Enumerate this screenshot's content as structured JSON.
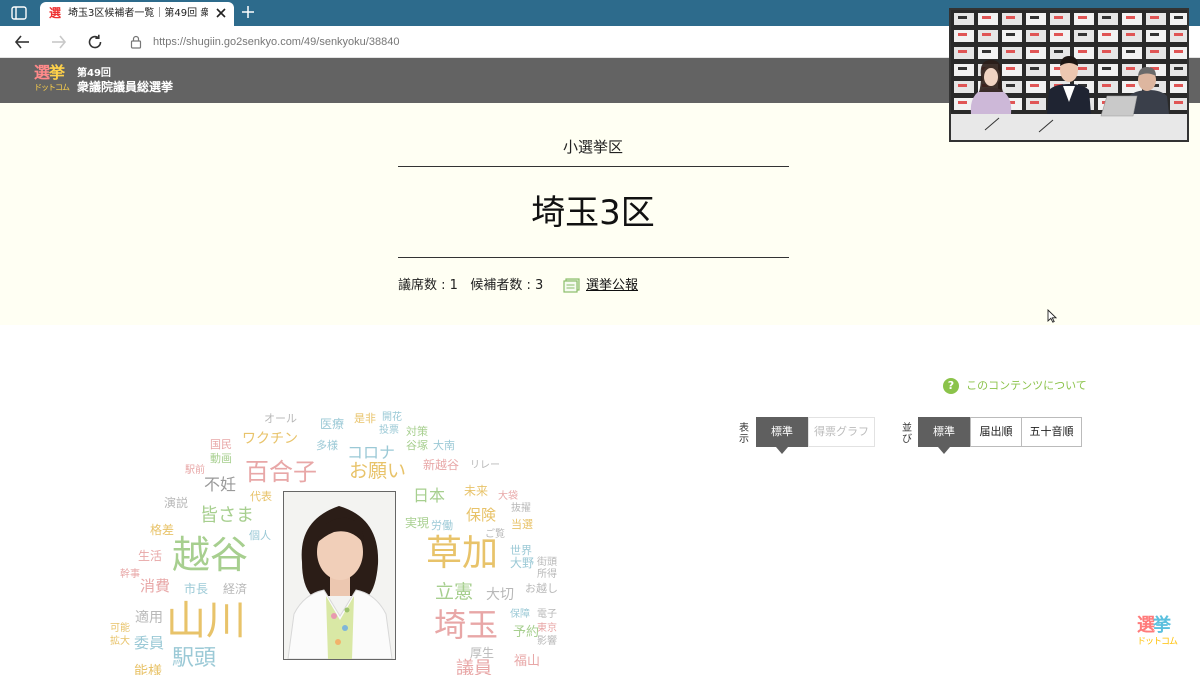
{
  "browser": {
    "tab_title": "埼玉3区候補者一覧｜第49回 衆議院議員総選挙",
    "tab_favicon": "選",
    "url": "https://shugiin.go2senkyo.com/49/senkyoku/38840"
  },
  "header": {
    "logo_kanji_1": "選",
    "logo_kanji_2": "挙",
    "logo_sub": "ドットコム",
    "election_number": "第49回",
    "election_name": "衆議院議員総選挙"
  },
  "district": {
    "type": "小選挙区",
    "name": "埼玉3区",
    "seats": "議席数 : 1",
    "candidates": "候補者数 : 3",
    "bulletin_link": "選挙公報"
  },
  "content": {
    "about_icon": "?",
    "about_link": "このコンテンツについて",
    "display_label": "表示",
    "display_standard": "標準",
    "display_graph": "得票グラフ",
    "sort_label": "並び",
    "sort_standard": "標準",
    "sort_filing": "届出順",
    "sort_gojuon": "五十音順"
  },
  "wordcloud": [
    {
      "text": "オール",
      "color": "#b8b8b8",
      "size": 11
    },
    {
      "text": "医療",
      "color": "#9bc9d6",
      "size": 12
    },
    {
      "text": "是非",
      "color": "#e8c36a",
      "size": 11
    },
    {
      "text": "開花",
      "color": "#9bc9d6",
      "size": 10
    },
    {
      "text": "国民",
      "color": "#e8a7a7",
      "size": 11
    },
    {
      "text": "ワクチン",
      "color": "#e8c36a",
      "size": 14
    },
    {
      "text": "多様",
      "color": "#9bc9d6",
      "size": 11
    },
    {
      "text": "投票",
      "color": "#9bc9d6",
      "size": 10
    },
    {
      "text": "対策",
      "color": "#a7cf8f",
      "size": 11
    },
    {
      "text": "動画",
      "color": "#a7cf8f",
      "size": 11
    },
    {
      "text": "谷塚",
      "color": "#a7cf8f",
      "size": 11
    },
    {
      "text": "大南",
      "color": "#9bc9d6",
      "size": 11
    },
    {
      "text": "コロナ",
      "color": "#9bc9d6",
      "size": 16
    },
    {
      "text": "百合子",
      "color": "#e8a7a7",
      "size": 24
    },
    {
      "text": "駅前",
      "color": "#e8a7a7",
      "size": 10
    },
    {
      "text": "お願い",
      "color": "#e8c36a",
      "size": 19
    },
    {
      "text": "新越谷",
      "color": "#e8a7a7",
      "size": 12
    },
    {
      "text": "リレー",
      "color": "#b8b8b8",
      "size": 10
    },
    {
      "text": "不妊",
      "color": "#9a9a9a",
      "size": 16
    },
    {
      "text": "演説",
      "color": "#b8b8b8",
      "size": 12
    },
    {
      "text": "代表",
      "color": "#e8c36a",
      "size": 11
    },
    {
      "text": "日本",
      "color": "#a7cf8f",
      "size": 16
    },
    {
      "text": "未来",
      "color": "#e8c36a",
      "size": 12
    },
    {
      "text": "大袋",
      "color": "#e8a7a7",
      "size": 10
    },
    {
      "text": "皆さま",
      "color": "#a7cf8f",
      "size": 18
    },
    {
      "text": "保険",
      "color": "#e8c36a",
      "size": 15
    },
    {
      "text": "抜擢",
      "color": "#b8b8b8",
      "size": 10
    },
    {
      "text": "格差",
      "color": "#e8c36a",
      "size": 12
    },
    {
      "text": "個人",
      "color": "#9bc9d6",
      "size": 11
    },
    {
      "text": "実現",
      "color": "#a7cf8f",
      "size": 12
    },
    {
      "text": "労働",
      "color": "#9bc9d6",
      "size": 11
    },
    {
      "text": "当選",
      "color": "#e8c36a",
      "size": 11
    },
    {
      "text": "ご覧",
      "color": "#b8b8b8",
      "size": 10
    },
    {
      "text": "越谷",
      "color": "#a7cf8f",
      "size": 38
    },
    {
      "text": "草加",
      "color": "#e8c36a",
      "size": 36
    },
    {
      "text": "生活",
      "color": "#e8a7a7",
      "size": 12
    },
    {
      "text": "世界",
      "color": "#9bc9d6",
      "size": 11
    },
    {
      "text": "大野",
      "color": "#9bc9d6",
      "size": 12
    },
    {
      "text": "街頭",
      "color": "#b8b8b8",
      "size": 10
    },
    {
      "text": "幹事",
      "color": "#e8a7a7",
      "size": 10
    },
    {
      "text": "所得",
      "color": "#b8b8b8",
      "size": 10
    },
    {
      "text": "消費",
      "color": "#e8a7a7",
      "size": 15
    },
    {
      "text": "市長",
      "color": "#9bc9d6",
      "size": 12
    },
    {
      "text": "経済",
      "color": "#b8b8b8",
      "size": 12
    },
    {
      "text": "立憲",
      "color": "#a7cf8f",
      "size": 19
    },
    {
      "text": "大切",
      "color": "#b8b8b8",
      "size": 14
    },
    {
      "text": "お越し",
      "color": "#b8b8b8",
      "size": 11
    },
    {
      "text": "山川",
      "color": "#e8c36a",
      "size": 40
    },
    {
      "text": "保障",
      "color": "#9bc9d6",
      "size": 10
    },
    {
      "text": "電子",
      "color": "#b8b8b8",
      "size": 10
    },
    {
      "text": "適用",
      "color": "#b8b8b8",
      "size": 14
    },
    {
      "text": "可能",
      "color": "#e8c36a",
      "size": 10
    },
    {
      "text": "埼玉",
      "color": "#e8a7a7",
      "size": 32
    },
    {
      "text": "東京",
      "color": "#e8a7a7",
      "size": 10
    },
    {
      "text": "予約",
      "color": "#a7cf8f",
      "size": 13
    },
    {
      "text": "拡大",
      "color": "#e8c36a",
      "size": 10
    },
    {
      "text": "委員",
      "color": "#9bc9d6",
      "size": 15
    },
    {
      "text": "影響",
      "color": "#b8b8b8",
      "size": 10
    },
    {
      "text": "厚生",
      "color": "#b8b8b8",
      "size": 12
    },
    {
      "text": "駅頭",
      "color": "#9bc9d6",
      "size": 22
    },
    {
      "text": "福山",
      "color": "#e8a7a7",
      "size": 13
    },
    {
      "text": "議員",
      "color": "#e8a7a7",
      "size": 18
    },
    {
      "text": "能様",
      "color": "#e8c36a",
      "size": 14
    }
  ],
  "colors": {
    "tabbar": "#2d6b8c",
    "site_header": "#636363",
    "district_band": "#fffff3",
    "accent_green": "#8bc34a",
    "segment_active": "#5f5f5f"
  }
}
